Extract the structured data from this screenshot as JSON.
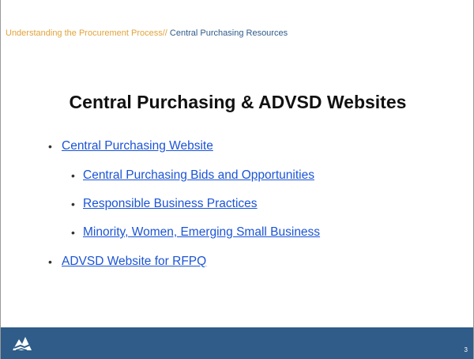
{
  "header": {
    "primary": "Understanding the Procurement Process",
    "separator": "//",
    "secondary": " Central Purchasing Resources"
  },
  "title": "Central Purchasing & ADVSD Websites",
  "bullets": [
    {
      "level": 1,
      "text": "Central Purchasing Website"
    },
    {
      "level": 2,
      "text": "Central Purchasing Bids and Opportunities"
    },
    {
      "level": 2,
      "text": "Responsible Business Practices"
    },
    {
      "level": 2,
      "text": "Minority, Women, Emerging Small Business"
    },
    {
      "level": 1,
      "text": "ADVSD Website for RFPQ"
    }
  ],
  "bullet_symbol": "•",
  "footer": {
    "logo_icon": "mountain-logo-icon",
    "page_number": "3"
  },
  "colors": {
    "header_primary": "#e1a33a",
    "header_secondary": "#2f5b8a",
    "link": "#1b54d6",
    "footer_bar": "#2f5c88"
  }
}
